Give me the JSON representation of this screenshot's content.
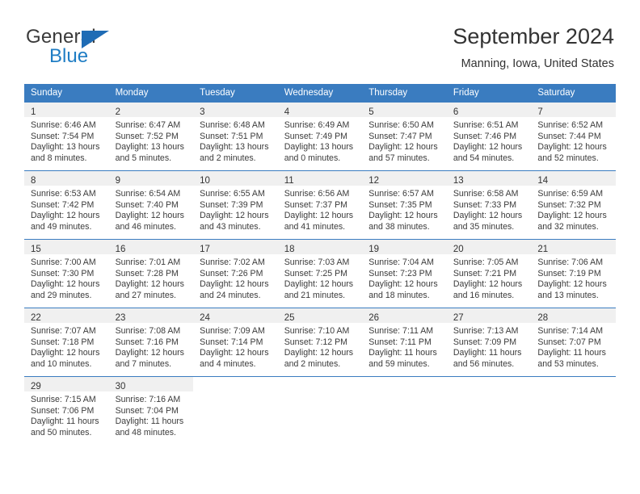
{
  "brand": {
    "name_top": "General",
    "name_bottom": "Blue",
    "accent_color": "#1f7dc4",
    "triangle_color": "#1f6cb5"
  },
  "header": {
    "title": "September 2024",
    "location": "Manning, Iowa, United States"
  },
  "calendar": {
    "header_bg": "#3a7cc0",
    "header_text_color": "#ffffff",
    "daynum_band_bg": "#f0f0f0",
    "weekday_headers": [
      "Sunday",
      "Monday",
      "Tuesday",
      "Wednesday",
      "Thursday",
      "Friday",
      "Saturday"
    ],
    "weeks": [
      [
        {
          "day": "1",
          "sunrise": "Sunrise: 6:46 AM",
          "sunset": "Sunset: 7:54 PM",
          "daylight_line1": "Daylight: 13 hours",
          "daylight_line2": "and 8 minutes."
        },
        {
          "day": "2",
          "sunrise": "Sunrise: 6:47 AM",
          "sunset": "Sunset: 7:52 PM",
          "daylight_line1": "Daylight: 13 hours",
          "daylight_line2": "and 5 minutes."
        },
        {
          "day": "3",
          "sunrise": "Sunrise: 6:48 AM",
          "sunset": "Sunset: 7:51 PM",
          "daylight_line1": "Daylight: 13 hours",
          "daylight_line2": "and 2 minutes."
        },
        {
          "day": "4",
          "sunrise": "Sunrise: 6:49 AM",
          "sunset": "Sunset: 7:49 PM",
          "daylight_line1": "Daylight: 13 hours",
          "daylight_line2": "and 0 minutes."
        },
        {
          "day": "5",
          "sunrise": "Sunrise: 6:50 AM",
          "sunset": "Sunset: 7:47 PM",
          "daylight_line1": "Daylight: 12 hours",
          "daylight_line2": "and 57 minutes."
        },
        {
          "day": "6",
          "sunrise": "Sunrise: 6:51 AM",
          "sunset": "Sunset: 7:46 PM",
          "daylight_line1": "Daylight: 12 hours",
          "daylight_line2": "and 54 minutes."
        },
        {
          "day": "7",
          "sunrise": "Sunrise: 6:52 AM",
          "sunset": "Sunset: 7:44 PM",
          "daylight_line1": "Daylight: 12 hours",
          "daylight_line2": "and 52 minutes."
        }
      ],
      [
        {
          "day": "8",
          "sunrise": "Sunrise: 6:53 AM",
          "sunset": "Sunset: 7:42 PM",
          "daylight_line1": "Daylight: 12 hours",
          "daylight_line2": "and 49 minutes."
        },
        {
          "day": "9",
          "sunrise": "Sunrise: 6:54 AM",
          "sunset": "Sunset: 7:40 PM",
          "daylight_line1": "Daylight: 12 hours",
          "daylight_line2": "and 46 minutes."
        },
        {
          "day": "10",
          "sunrise": "Sunrise: 6:55 AM",
          "sunset": "Sunset: 7:39 PM",
          "daylight_line1": "Daylight: 12 hours",
          "daylight_line2": "and 43 minutes."
        },
        {
          "day": "11",
          "sunrise": "Sunrise: 6:56 AM",
          "sunset": "Sunset: 7:37 PM",
          "daylight_line1": "Daylight: 12 hours",
          "daylight_line2": "and 41 minutes."
        },
        {
          "day": "12",
          "sunrise": "Sunrise: 6:57 AM",
          "sunset": "Sunset: 7:35 PM",
          "daylight_line1": "Daylight: 12 hours",
          "daylight_line2": "and 38 minutes."
        },
        {
          "day": "13",
          "sunrise": "Sunrise: 6:58 AM",
          "sunset": "Sunset: 7:33 PM",
          "daylight_line1": "Daylight: 12 hours",
          "daylight_line2": "and 35 minutes."
        },
        {
          "day": "14",
          "sunrise": "Sunrise: 6:59 AM",
          "sunset": "Sunset: 7:32 PM",
          "daylight_line1": "Daylight: 12 hours",
          "daylight_line2": "and 32 minutes."
        }
      ],
      [
        {
          "day": "15",
          "sunrise": "Sunrise: 7:00 AM",
          "sunset": "Sunset: 7:30 PM",
          "daylight_line1": "Daylight: 12 hours",
          "daylight_line2": "and 29 minutes."
        },
        {
          "day": "16",
          "sunrise": "Sunrise: 7:01 AM",
          "sunset": "Sunset: 7:28 PM",
          "daylight_line1": "Daylight: 12 hours",
          "daylight_line2": "and 27 minutes."
        },
        {
          "day": "17",
          "sunrise": "Sunrise: 7:02 AM",
          "sunset": "Sunset: 7:26 PM",
          "daylight_line1": "Daylight: 12 hours",
          "daylight_line2": "and 24 minutes."
        },
        {
          "day": "18",
          "sunrise": "Sunrise: 7:03 AM",
          "sunset": "Sunset: 7:25 PM",
          "daylight_line1": "Daylight: 12 hours",
          "daylight_line2": "and 21 minutes."
        },
        {
          "day": "19",
          "sunrise": "Sunrise: 7:04 AM",
          "sunset": "Sunset: 7:23 PM",
          "daylight_line1": "Daylight: 12 hours",
          "daylight_line2": "and 18 minutes."
        },
        {
          "day": "20",
          "sunrise": "Sunrise: 7:05 AM",
          "sunset": "Sunset: 7:21 PM",
          "daylight_line1": "Daylight: 12 hours",
          "daylight_line2": "and 16 minutes."
        },
        {
          "day": "21",
          "sunrise": "Sunrise: 7:06 AM",
          "sunset": "Sunset: 7:19 PM",
          "daylight_line1": "Daylight: 12 hours",
          "daylight_line2": "and 13 minutes."
        }
      ],
      [
        {
          "day": "22",
          "sunrise": "Sunrise: 7:07 AM",
          "sunset": "Sunset: 7:18 PM",
          "daylight_line1": "Daylight: 12 hours",
          "daylight_line2": "and 10 minutes."
        },
        {
          "day": "23",
          "sunrise": "Sunrise: 7:08 AM",
          "sunset": "Sunset: 7:16 PM",
          "daylight_line1": "Daylight: 12 hours",
          "daylight_line2": "and 7 minutes."
        },
        {
          "day": "24",
          "sunrise": "Sunrise: 7:09 AM",
          "sunset": "Sunset: 7:14 PM",
          "daylight_line1": "Daylight: 12 hours",
          "daylight_line2": "and 4 minutes."
        },
        {
          "day": "25",
          "sunrise": "Sunrise: 7:10 AM",
          "sunset": "Sunset: 7:12 PM",
          "daylight_line1": "Daylight: 12 hours",
          "daylight_line2": "and 2 minutes."
        },
        {
          "day": "26",
          "sunrise": "Sunrise: 7:11 AM",
          "sunset": "Sunset: 7:11 PM",
          "daylight_line1": "Daylight: 11 hours",
          "daylight_line2": "and 59 minutes."
        },
        {
          "day": "27",
          "sunrise": "Sunrise: 7:13 AM",
          "sunset": "Sunset: 7:09 PM",
          "daylight_line1": "Daylight: 11 hours",
          "daylight_line2": "and 56 minutes."
        },
        {
          "day": "28",
          "sunrise": "Sunrise: 7:14 AM",
          "sunset": "Sunset: 7:07 PM",
          "daylight_line1": "Daylight: 11 hours",
          "daylight_line2": "and 53 minutes."
        }
      ],
      [
        {
          "day": "29",
          "sunrise": "Sunrise: 7:15 AM",
          "sunset": "Sunset: 7:06 PM",
          "daylight_line1": "Daylight: 11 hours",
          "daylight_line2": "and 50 minutes."
        },
        {
          "day": "30",
          "sunrise": "Sunrise: 7:16 AM",
          "sunset": "Sunset: 7:04 PM",
          "daylight_line1": "Daylight: 11 hours",
          "daylight_line2": "and 48 minutes."
        },
        {
          "day": "",
          "sunrise": "",
          "sunset": "",
          "daylight_line1": "",
          "daylight_line2": ""
        },
        {
          "day": "",
          "sunrise": "",
          "sunset": "",
          "daylight_line1": "",
          "daylight_line2": ""
        },
        {
          "day": "",
          "sunrise": "",
          "sunset": "",
          "daylight_line1": "",
          "daylight_line2": ""
        },
        {
          "day": "",
          "sunrise": "",
          "sunset": "",
          "daylight_line1": "",
          "daylight_line2": ""
        },
        {
          "day": "",
          "sunrise": "",
          "sunset": "",
          "daylight_line1": "",
          "daylight_line2": ""
        }
      ]
    ]
  }
}
